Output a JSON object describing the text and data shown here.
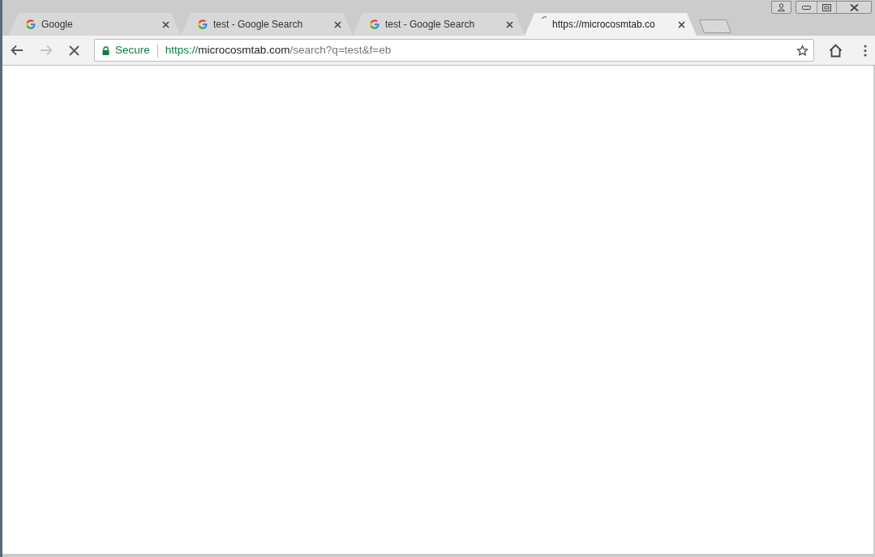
{
  "tabs": [
    {
      "title": "Google",
      "kind": "google",
      "selected": false
    },
    {
      "title": "test - Google Search",
      "kind": "google",
      "selected": false
    },
    {
      "title": "test - Google Search",
      "kind": "google",
      "selected": false
    },
    {
      "title": "https://microcosmtab.co",
      "kind": "loading",
      "selected": true
    }
  ],
  "toolbar": {
    "loading": true,
    "forward_disabled": true
  },
  "address_bar": {
    "security": "Secure",
    "url": {
      "scheme": "https://",
      "host": "microcosmtab.com",
      "path": "/search?q=test&f=eb"
    },
    "bookmarked": false
  }
}
